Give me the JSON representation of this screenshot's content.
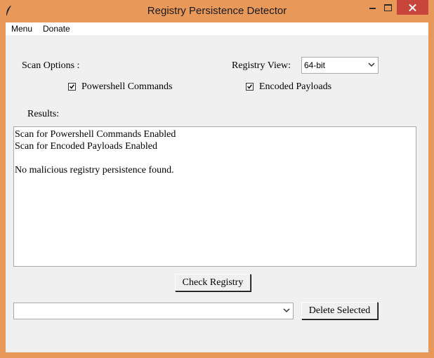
{
  "window": {
    "title": "Registry Persistence Detector",
    "icon": "feather-icon",
    "controls": [
      "minimize-icon",
      "maximize-icon",
      "close-icon"
    ]
  },
  "menubar": {
    "items": [
      {
        "label": "Menu"
      },
      {
        "label": "Donate"
      }
    ]
  },
  "options": {
    "scan_label": "Scan Options :",
    "registry_view_label": "Registry View:",
    "registry_view_value": "64-bit",
    "powershell": {
      "label": "Powershell Commands",
      "checked": true
    },
    "encoded": {
      "label": "Encoded Payloads",
      "checked": true
    }
  },
  "results": {
    "label": "Results:",
    "lines": [
      "Scan for Powershell Commands Enabled",
      "Scan for Encoded Payloads Enabled",
      "",
      "No malicious registry persistence found."
    ]
  },
  "actions": {
    "check_label": "Check Registry",
    "item_select_value": "",
    "delete_label": "Delete Selected"
  },
  "colors": {
    "window_frame": "#e8995a",
    "close_button": "#c7453b",
    "client_bg": "#f0f0f0"
  }
}
